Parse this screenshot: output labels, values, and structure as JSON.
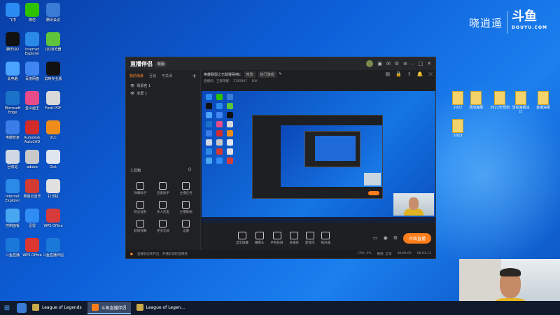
{
  "watermark": {
    "text": "晓逍遥",
    "logo": "斗鱼",
    "sub": "DOUYU.COM"
  },
  "desktop_icons": [
    {
      "label": "飞书",
      "color": "#2a8bf2"
    },
    {
      "label": "微信",
      "color": "#2dc100"
    },
    {
      "label": "腾讯会议",
      "color": "#3a7bd5"
    },
    {
      "label": "腾讯QQ",
      "color": "#111111"
    },
    {
      "label": "Internet Explorer",
      "color": "#2b8ae8"
    },
    {
      "label": "QQ浏览器",
      "color": "#5fc43b"
    },
    {
      "label": "此电脑",
      "color": "#4aa3ff"
    },
    {
      "label": "百度网盘",
      "color": "#3f86f2"
    },
    {
      "label": "剪映专业版",
      "color": "#111111"
    },
    {
      "label": "Microsoft Edge",
      "color": "#1b73c9"
    },
    {
      "label": "金山画王",
      "color": "#e84b8a"
    },
    {
      "label": "Foxit PDF",
      "color": "#d9d9d9"
    },
    {
      "label": "电脑管家",
      "color": "#3b7de8"
    },
    {
      "label": "Autodesk AutoCAD",
      "color": "#d22b2b"
    },
    {
      "label": "VLC",
      "color": "#f08c1a"
    },
    {
      "label": "回收站",
      "color": "#cfd8e3"
    },
    {
      "label": "adobe",
      "color": "#c9c9c9"
    },
    {
      "label": "Dict",
      "color": "#e0e6f0"
    },
    {
      "label": "Internet Explorer",
      "color": "#2b8ae8"
    },
    {
      "label": "网易云音乐",
      "color": "#d33a31"
    },
    {
      "label": "打印机",
      "color": "#e0e0e0"
    },
    {
      "label": "控制面板",
      "color": "#49a6f0"
    },
    {
      "label": "迅雷",
      "color": "#2f8df4"
    },
    {
      "label": "WPS Office",
      "color": "#d73c3c"
    },
    {
      "label": "斗鱼直播",
      "color": "#1a78d8"
    },
    {
      "label": "WPS Office",
      "color": "#d9372f"
    },
    {
      "label": "斗鱼直播伴侣",
      "color": "#1a78d8"
    }
  ],
  "right_files": [
    {
      "label": "2022"
    },
    {
      "label": "活动海报"
    },
    {
      "label": "2022年规划"
    },
    {
      "label": "活动海报设计"
    },
    {
      "label": "直播海报"
    },
    {
      "label": "2023"
    }
  ],
  "app": {
    "logo": "直播伴侣",
    "version": "新版",
    "left_tabs": [
      "我的场景",
      "互动",
      "可关闭"
    ],
    "scenes": [
      "场景名 1",
      "全屏 1"
    ],
    "tools_header": "工具箱",
    "tools": [
      "弹幕助手",
      "连麦助手",
      "主播任务",
      "粉丝福利",
      "多人连麦",
      "主播数据",
      "超级弹幕",
      "更多功能",
      "设置"
    ],
    "room_title": "英雄联盟之无敌猴哥纯C",
    "room_edit": "修改",
    "room_category": "热门游戏",
    "room_info": [
      "直播间：王者荣耀",
      "1745997",
      "10K"
    ],
    "bottom_tools": [
      "显示屏幕",
      "摄像头",
      "手机投屏",
      "多媒体",
      "麦克风",
      "扬声器"
    ],
    "go_live": "开始直播",
    "status_warning": "直播状态未开启，开播前请检查网络",
    "status_right": [
      "CPU: 2%",
      "网络: 正常",
      "00:00:00",
      "00:01:11"
    ]
  },
  "taskbar": {
    "items": [
      {
        "label": "League of Legends",
        "active": false,
        "color": "#c9a94a"
      },
      {
        "label": "斗鱼直播伴侣",
        "active": true,
        "color": "#ff7d1a"
      },
      {
        "label": "League of Legen...",
        "active": false,
        "color": "#c9a94a"
      }
    ]
  }
}
